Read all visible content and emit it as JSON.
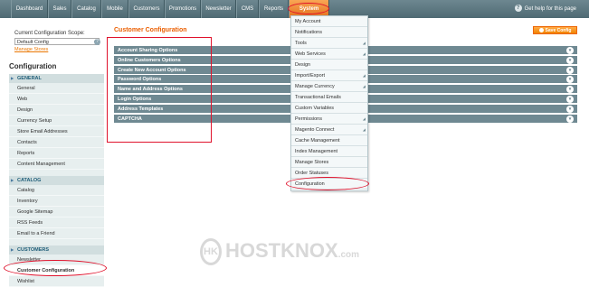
{
  "topnav": {
    "items": [
      {
        "label": "Dashboard"
      },
      {
        "label": "Sales"
      },
      {
        "label": "Catalog"
      },
      {
        "label": "Mobile"
      },
      {
        "label": "Customers"
      },
      {
        "label": "Promotions"
      },
      {
        "label": "Newsletter"
      },
      {
        "label": "CMS"
      },
      {
        "label": "Reports"
      },
      {
        "label": "System"
      }
    ],
    "help_label": "Get help for this page"
  },
  "sidebar": {
    "scope_label": "Current Configuration Scope:",
    "scope_value": "Default Config",
    "manage_stores": "Manage Stores",
    "title": "Configuration",
    "sections": [
      {
        "title": "GENERAL",
        "items": [
          "General",
          "Web",
          "Design",
          "Currency Setup",
          "Store Email Addresses",
          "Contacts",
          "Reports",
          "Content Management"
        ]
      },
      {
        "title": "CATALOG",
        "items": [
          "Catalog",
          "Inventory",
          "Google Sitemap",
          "RSS Feeds",
          "Email to a Friend"
        ]
      },
      {
        "title": "CUSTOMERS",
        "items": [
          "Newsletter",
          "Customer Configuration",
          "Wishlist"
        ]
      }
    ]
  },
  "main": {
    "title": "Customer Configuration",
    "save_label": "Save Config",
    "sections": [
      "Account Sharing Options",
      "Online Customers Options",
      "Create New Account Options",
      "Password Options",
      "Name and Address Options",
      "Login Options",
      "Address Templates",
      "CAPTCHA"
    ]
  },
  "system_menu": {
    "items": [
      {
        "label": "My Account",
        "has_sub": false
      },
      {
        "label": "Notifications",
        "has_sub": false
      },
      {
        "label": "Tools",
        "has_sub": true
      },
      {
        "label": "Web Services",
        "has_sub": true
      },
      {
        "label": "Design",
        "has_sub": false
      },
      {
        "label": "Import/Export",
        "has_sub": true
      },
      {
        "label": "Manage Currency",
        "has_sub": true
      },
      {
        "label": "Transactional Emails",
        "has_sub": false
      },
      {
        "label": "Custom Variables",
        "has_sub": false
      },
      {
        "label": "Permissions",
        "has_sub": true
      },
      {
        "label": "Magento Connect",
        "has_sub": true
      },
      {
        "label": "Cache Management",
        "has_sub": false
      },
      {
        "label": "Index Management",
        "has_sub": false
      },
      {
        "label": "Manage Stores",
        "has_sub": false
      },
      {
        "label": "Order Statuses",
        "has_sub": false
      },
      {
        "label": "Configuration",
        "has_sub": false
      }
    ]
  },
  "watermark": {
    "brand": "HOSTKNOX",
    "suffix": ".com",
    "mark": "HK"
  },
  "colors": {
    "accent": "#eb5e00",
    "nav": "#5b757e",
    "section_bar": "#6f8992",
    "annotation": "#e0122c"
  }
}
